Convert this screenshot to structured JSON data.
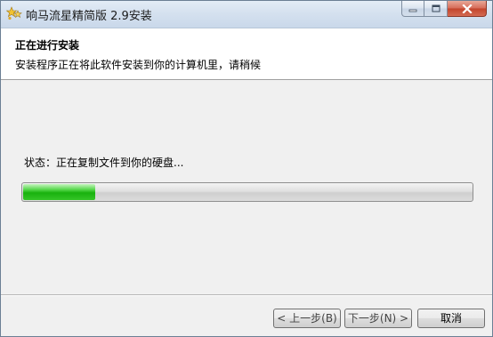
{
  "window": {
    "title": "响马流星精简版 2.9安装"
  },
  "header": {
    "title": "正在进行安装",
    "subtitle": "安装程序正在将此软件安装到你的计算机里，请稍候"
  },
  "status": {
    "text": "状态：正在复制文件到你的硬盘..."
  },
  "progress": {
    "value_fraction": 0.16
  },
  "buttons": {
    "back_label": "< 上一步(B)",
    "next_label": "下一步(N) >",
    "cancel_label": "取消"
  },
  "icons": {
    "app": "app-star-icon",
    "minimize": "minimize-icon",
    "maximize": "maximize-icon",
    "close": "close-icon"
  },
  "colors": {
    "progress_green": "#19b20e",
    "close_red": "#c2442b"
  }
}
